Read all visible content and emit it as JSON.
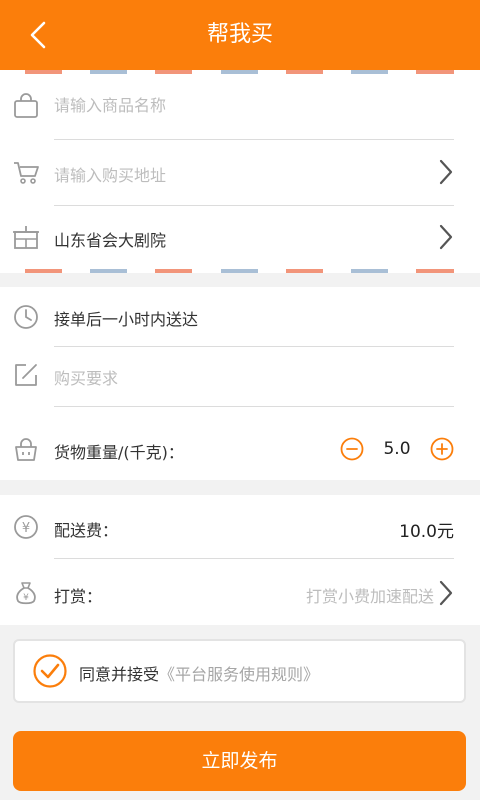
{
  "header": {
    "title": "帮我买"
  },
  "theme": {
    "accent": "#fb7e0b",
    "stripe_red": "#f2957a",
    "stripe_blue": "#a9bfd6"
  },
  "form": {
    "product_name": {
      "placeholder": "请输入商品名称",
      "value": ""
    },
    "purchase_address": {
      "placeholder": "请输入购买地址"
    },
    "delivery_address": {
      "value": "山东省会大剧院"
    },
    "delivery_time": {
      "value": "接单后一小时内送达"
    },
    "requirements": {
      "placeholder": "购买要求"
    },
    "weight": {
      "label": "货物重量/(千克)：",
      "value": "5.0"
    }
  },
  "fees": {
    "delivery_label": "配送费：",
    "delivery_value": "10.0元",
    "tip_label": "打赏：",
    "tip_hint": "打赏小费加速配送"
  },
  "agreement": {
    "text": "同意并接受",
    "link": "《平台服务使用规则》",
    "checked": true
  },
  "submit": {
    "label": "立即发布"
  },
  "icons": [
    "back-chevron-icon",
    "shopping-bag-icon",
    "shopping-cart-icon",
    "store-icon",
    "clock-icon",
    "edit-icon",
    "weight-basket-icon",
    "yen-coin-icon",
    "money-bag-icon",
    "chevron-right-icon",
    "minus-circle-icon",
    "plus-circle-icon",
    "check-circle-icon"
  ]
}
